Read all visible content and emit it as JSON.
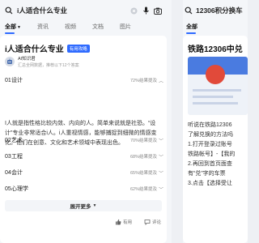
{
  "search": {
    "query": "i人适合什么专业"
  },
  "tabs": [
    {
      "label": "全部"
    },
    {
      "label": "资讯"
    },
    {
      "label": "视频"
    },
    {
      "label": "文档"
    },
    {
      "label": "图片"
    }
  ],
  "card": {
    "title": "i人适合什么专业",
    "badge": "有用攻略",
    "author_name": "AI知识君",
    "author_sub": "汇总全网数据，推荐以下12个答案",
    "options": [
      {
        "idx": "01",
        "label": "设计",
        "pct": "72%结果提及"
      },
      {
        "idx": "02",
        "label": "艺术",
        "pct": "70%结果提及"
      },
      {
        "idx": "03",
        "label": "工程",
        "pct": "68%结果提及"
      },
      {
        "idx": "04",
        "label": "会计",
        "pct": "65%结果提及"
      },
      {
        "idx": "05",
        "label": "心理学",
        "pct": "62%结果提及"
      }
    ],
    "description": "I人就是指性格比较内敛、内向的人。简单来说就是社恐。“设计”专业非常适合i人。i人重视情感，能够捕捉到细微的情感变化。他们在创意、文化和艺术领域中表现出色。",
    "more_label": "展开更多",
    "like_label": "有用",
    "comment_label": "评论"
  },
  "right": {
    "query": "12306积分换车",
    "tab": "全部",
    "title": "铁路12306中兑",
    "lines": [
      "听说在铁路12306",
      "了解兑换的方法吗",
      "1.打开登录过账号",
      "铁路帐号】-【我的",
      "2.再回到首页面查",
      "有“兑”字的车票",
      "3.点击【选择受让"
    ]
  },
  "colors": {
    "accent": "#2f6bff",
    "card": "#ffffff",
    "background": "#f4f6f9"
  }
}
